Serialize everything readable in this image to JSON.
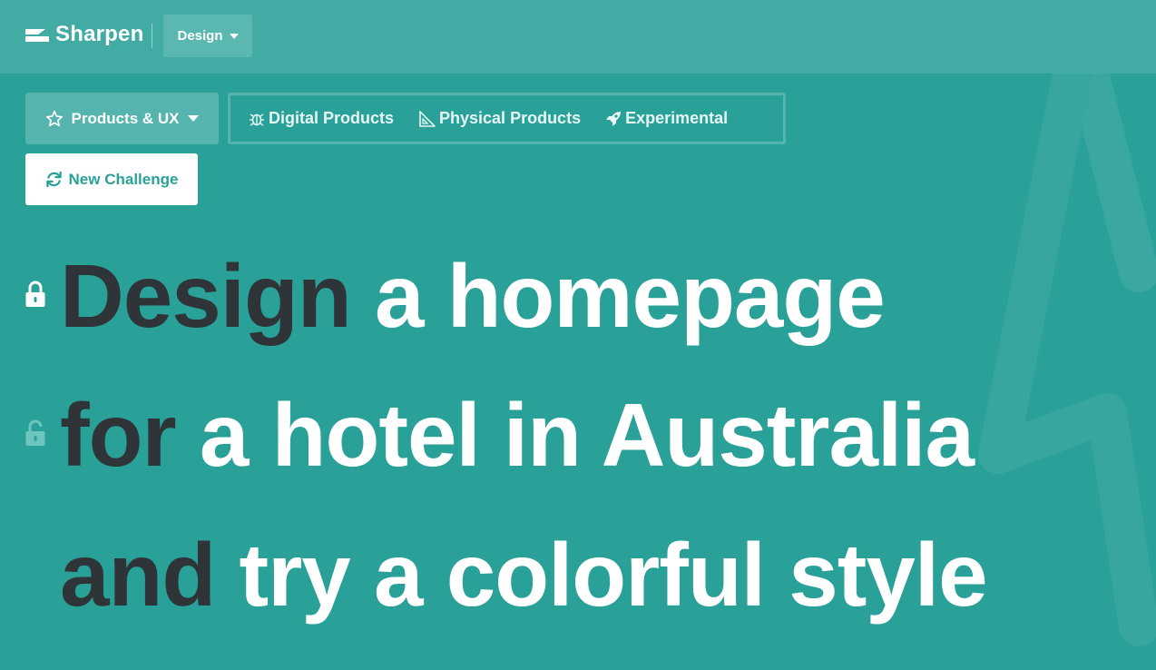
{
  "header": {
    "brand": "Sharpen",
    "mode_dropdown": {
      "label": "Design"
    }
  },
  "filters": {
    "category_dropdown": {
      "label": "Products & UX",
      "icon": "star-icon"
    },
    "subcategories": [
      {
        "label": "Digital Products",
        "icon": "bug-icon"
      },
      {
        "label": "Physical Products",
        "icon": "set-square-icon"
      },
      {
        "label": "Experimental",
        "icon": "rocket-icon"
      }
    ]
  },
  "actions": {
    "new_challenge": "New Challenge"
  },
  "challenge": {
    "lines": [
      {
        "verb": "Design",
        "rest": "a homepage",
        "lock": "locked"
      },
      {
        "verb": "for",
        "rest": "a hotel in Australia",
        "lock": "unlocked"
      },
      {
        "verb": "and",
        "rest": "try a colorful style",
        "lock": "none"
      }
    ]
  },
  "colors": {
    "background": "#2aa198",
    "topbar": "#42aca4",
    "verb_text": "#2e3437",
    "prompt_text": "#ffffff"
  }
}
